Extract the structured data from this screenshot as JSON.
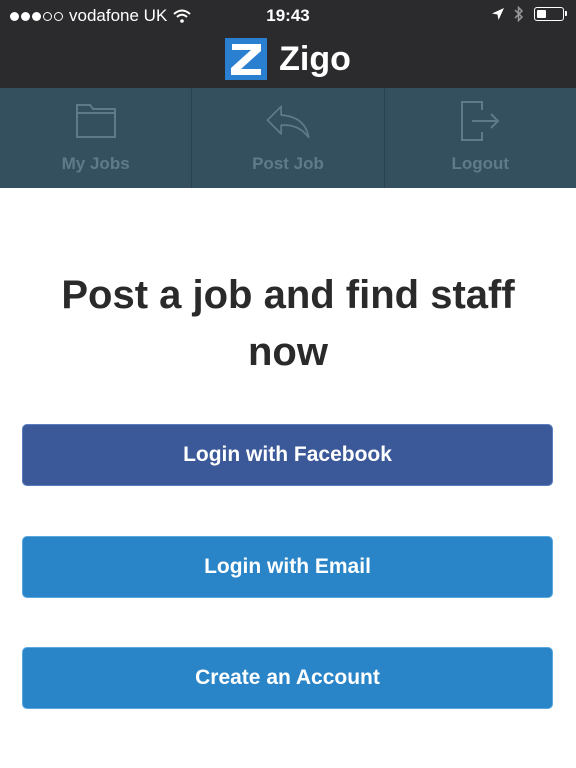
{
  "status_bar": {
    "carrier": "vodafone UK",
    "time": "19:43",
    "signal_dots_total": 5,
    "signal_dots_filled": 3,
    "icons": [
      "wifi-icon",
      "location-arrow-icon",
      "bluetooth-icon",
      "battery-icon"
    ]
  },
  "header": {
    "logo_letter": "Z",
    "brand": "Zigo"
  },
  "tabs": [
    {
      "label": "My Jobs",
      "icon": "folder-icon"
    },
    {
      "label": "Post Job",
      "icon": "reply-arrow-icon"
    },
    {
      "label": "Logout",
      "icon": "logout-icon"
    }
  ],
  "main": {
    "headline": "Post a job and find staff now",
    "buttons": {
      "facebook": "Login with Facebook",
      "email": "Login with Email",
      "create": "Create an Account"
    }
  },
  "colors": {
    "header_bg": "#2b2b2d",
    "tab_bar_bg": "#34505f",
    "facebook_blue": "#3b5998",
    "primary_blue": "#2a85c8",
    "logo_blue": "#2a7fd0"
  }
}
